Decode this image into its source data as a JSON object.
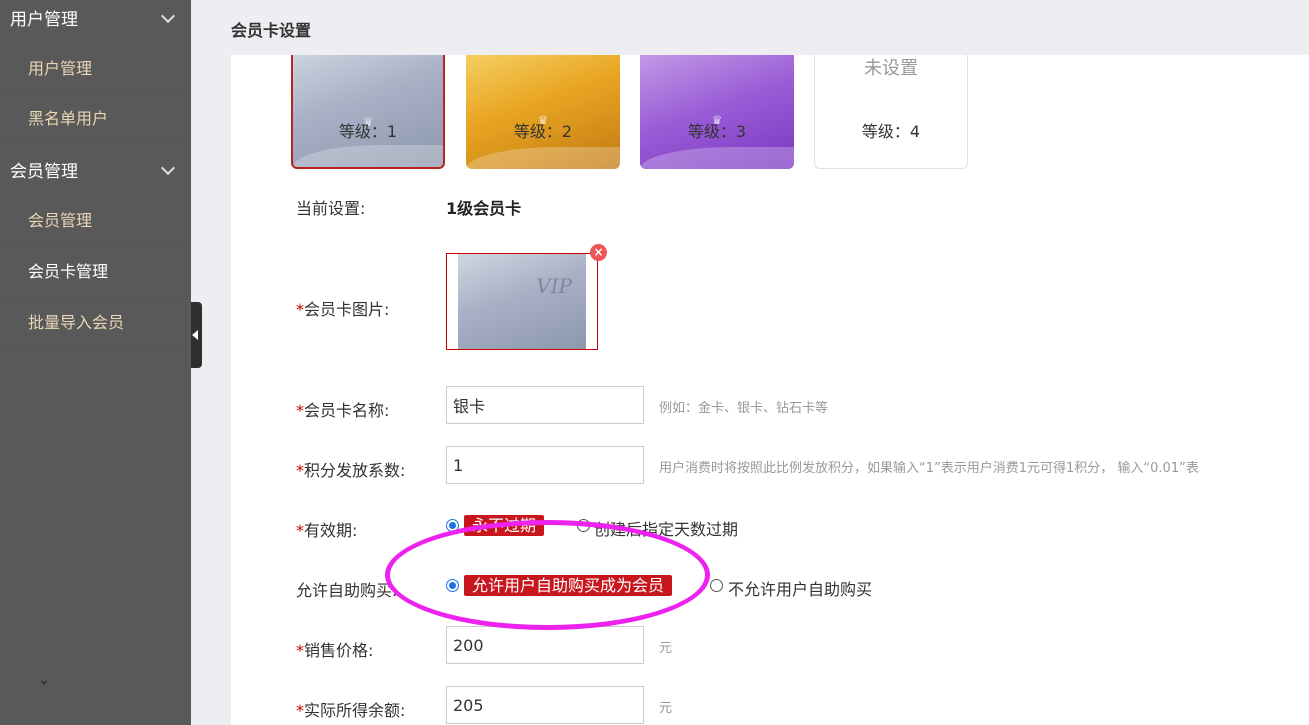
{
  "sidebar": {
    "groups": [
      {
        "title": "用户管理",
        "items": [
          "用户管理",
          "黑名单用户"
        ]
      },
      {
        "title": "会员管理",
        "items": [
          "会员管理",
          "会员卡管理",
          "批量导入会员"
        ]
      }
    ],
    "active_item": "会员卡管理"
  },
  "header": {
    "title": "会员卡设置"
  },
  "cards": [
    {
      "level": "等级：1",
      "style": "silver",
      "selected": true
    },
    {
      "level": "等级：2",
      "style": "gold",
      "selected": false
    },
    {
      "level": "等级：3",
      "style": "purple",
      "selected": false
    },
    {
      "level": "等级：4",
      "style": "unset",
      "selected": false,
      "label": "未设置"
    }
  ],
  "form": {
    "current": {
      "label": "当前设置:",
      "value": "1级会员卡"
    },
    "image": {
      "label": "会员卡图片:",
      "required": "*",
      "card_text": "VIP"
    },
    "name": {
      "label": "会员卡名称:",
      "required": "*",
      "value": "银卡",
      "hint": "例如：金卡、银卡、钻石卡等"
    },
    "points": {
      "label": "积分发放系数:",
      "required": "*",
      "value": "1",
      "hint": "用户消费时将按照此比例发放积分，如果输入“1”表示用户消费1元可得1积分， 输入“0.01”表"
    },
    "validity": {
      "label": "有效期:",
      "required": "*",
      "option_selected": "永不过期",
      "option_other": "创建后指定天数过期"
    },
    "self_purchase": {
      "label": "允许自助购买:",
      "option_selected": "允许用户自助购买成为会员",
      "option_other": "不允许用户自助购买"
    },
    "price": {
      "label": "销售价格:",
      "required": "*",
      "value": "200",
      "unit": "元"
    },
    "balance": {
      "label": "实际所得余额:",
      "required": "*",
      "value": "205",
      "unit": "元"
    }
  },
  "colors": {
    "sidebar_bg": "#595959",
    "nav_text": "#e8d6b4",
    "accent_red": "#c8161d",
    "radio_blue": "#1a73e8",
    "annotation": "#ee22ee"
  },
  "icons": {
    "chevron": "chevron-down-icon",
    "remove": "close-icon",
    "collapse": "caret-left-icon"
  }
}
